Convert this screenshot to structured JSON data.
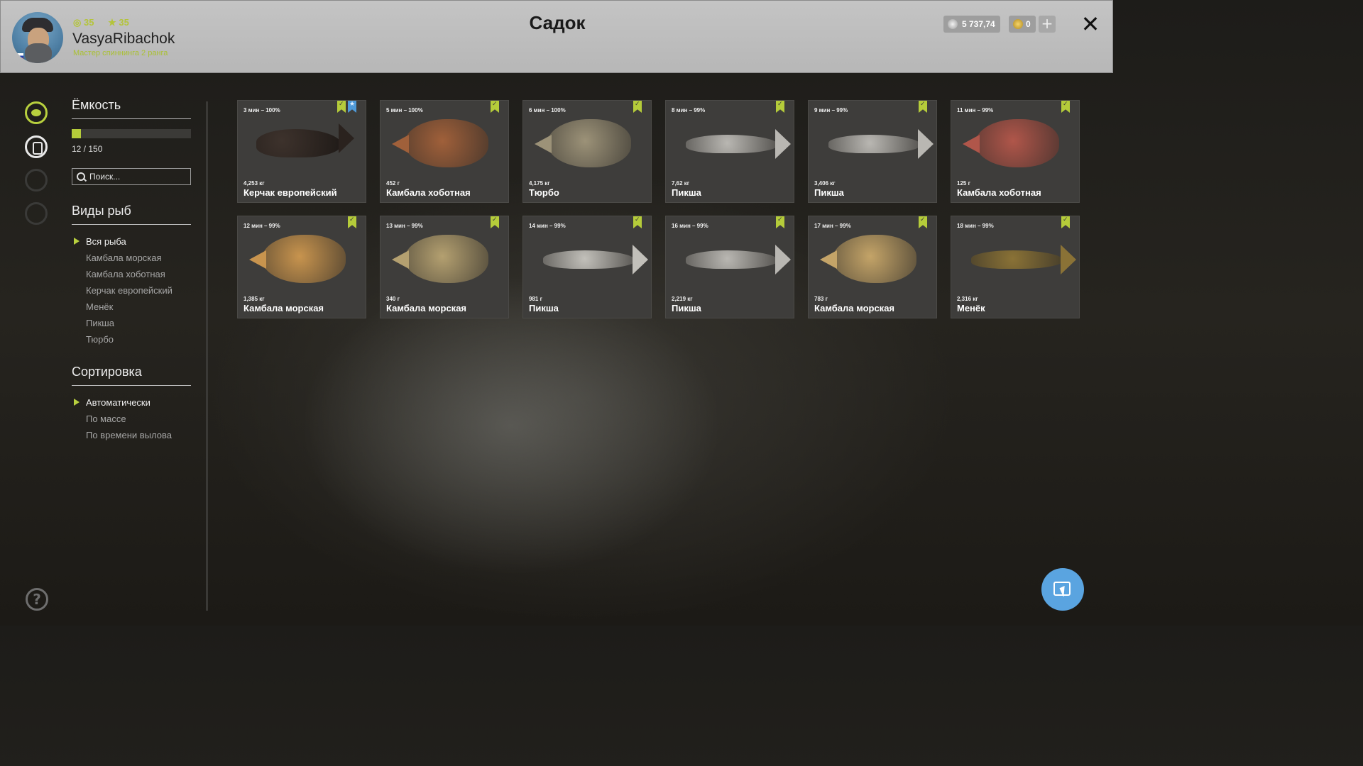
{
  "header": {
    "title": "Садок",
    "player": {
      "name": "VasyaRibachok",
      "rank_title": "Мастер спиннинга 2 ранга",
      "level": "35",
      "stars": "35"
    },
    "silver": "5 737,74",
    "gold": "0",
    "plus": "+",
    "close": "✕"
  },
  "sidebar": {
    "capacity": {
      "title": "Ёмкость",
      "text": "12 / 150",
      "used": 12,
      "max": 150
    },
    "search": {
      "placeholder": "Поиск..."
    },
    "species": {
      "title": "Виды рыб",
      "items": [
        "Вся рыба",
        "Камбала морская",
        "Камбала хоботная",
        "Керчак европейский",
        "Менёк",
        "Пикша",
        "Тюрбо"
      ],
      "active": 0
    },
    "sorting": {
      "title": "Сортировка",
      "items": [
        "Автоматически",
        "По массе",
        "По времени вылова"
      ],
      "active": 0
    },
    "help": "?"
  },
  "fish": [
    {
      "time": "3 мин – 100%",
      "weight": "4,253 кг",
      "name": "Керчак европейский",
      "shape": "sculpin",
      "trophy": true
    },
    {
      "time": "5 мин – 100%",
      "weight": "452 г",
      "name": "Камбала хоботная",
      "shape": "flat",
      "color": "#a0603a"
    },
    {
      "time": "6 мин – 100%",
      "weight": "4,175 кг",
      "name": "Тюрбо",
      "shape": "flat",
      "color": "#9c9278"
    },
    {
      "time": "8 мин – 99%",
      "weight": "7,62 кг",
      "name": "Пикша",
      "shape": "long",
      "color": "#b9b7b2"
    },
    {
      "time": "9 мин – 99%",
      "weight": "3,406 кг",
      "name": "Пикша",
      "shape": "long",
      "color": "#b9b7b2"
    },
    {
      "time": "11 мин – 99%",
      "weight": "125 г",
      "name": "Камбала хоботная",
      "shape": "flat",
      "color": "#b0564a"
    },
    {
      "time": "12 мин – 99%",
      "weight": "1,385 кг",
      "name": "Камбала морская",
      "shape": "flat",
      "color": "#c8944e"
    },
    {
      "time": "13 мин – 99%",
      "weight": "340 г",
      "name": "Камбала морская",
      "shape": "flat",
      "color": "#b4a070"
    },
    {
      "time": "14 мин – 99%",
      "weight": "981 г",
      "name": "Пикша",
      "shape": "long",
      "color": "#c2c0ba"
    },
    {
      "time": "16 мин – 99%",
      "weight": "2,219 кг",
      "name": "Пикша",
      "shape": "long",
      "color": "#b9b7b2"
    },
    {
      "time": "17 мин – 99%",
      "weight": "783 г",
      "name": "Камбала морская",
      "shape": "flat",
      "color": "#c4a468"
    },
    {
      "time": "18 мин – 99%",
      "weight": "2,316 кг",
      "name": "Менёк",
      "shape": "long",
      "color": "#8a7236"
    }
  ]
}
